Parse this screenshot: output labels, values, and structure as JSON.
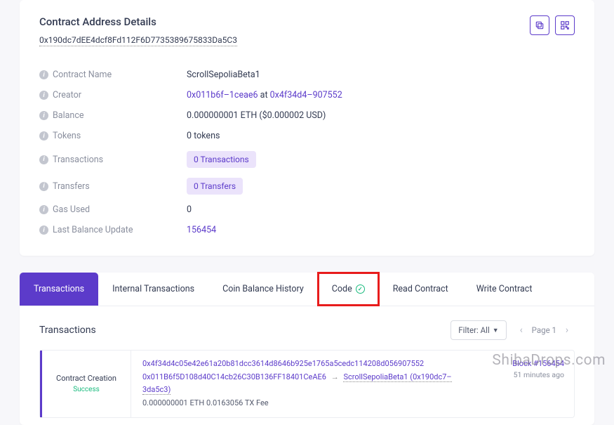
{
  "header": {
    "title": "Contract Address Details",
    "address": "0x190dc7dEE4dcf8Fd112F6D7735389675833Da5C3"
  },
  "details": {
    "contract_name": {
      "label": "Contract Name",
      "value": "ScrollSepoliaBeta1"
    },
    "creator": {
      "label": "Creator",
      "addr": "0x011b6f–1ceae6",
      "at": " at ",
      "tx": "0x4f34d4–907552"
    },
    "balance": {
      "label": "Balance",
      "value": "0.000000001 ETH ($0.000002 USD)"
    },
    "tokens": {
      "label": "Tokens",
      "value": "0 tokens"
    },
    "transactions": {
      "label": "Transactions",
      "badge": "0 Transactions"
    },
    "transfers": {
      "label": "Transfers",
      "badge": "0 Transfers"
    },
    "gas_used": {
      "label": "Gas Used",
      "value": "0"
    },
    "last_balance": {
      "label": "Last Balance Update",
      "link": "156454"
    }
  },
  "tabs": [
    {
      "label": "Transactions"
    },
    {
      "label": "Internal Transactions"
    },
    {
      "label": "Coin Balance History"
    },
    {
      "label": "Code"
    },
    {
      "label": "Read Contract"
    },
    {
      "label": "Write Contract"
    }
  ],
  "tx_section": {
    "title": "Transactions",
    "filter_label": "Filter: All",
    "page_label": "Page 1"
  },
  "tx_row": {
    "type": "Contract Creation",
    "status": "Success",
    "hash": "0x4f34d4c05e42e61a20b81dcc3614d8646b925e1765a5cedc114208d056907552",
    "from": "0x011B6f5D108d40C14cb26C30B136FF18401CeAE6",
    "to": "ScrollSepoliaBeta1 (0x190dc7–3da5c3)",
    "fee": "0.000000001 ETH 0.0163056 TX Fee",
    "block": "Block #156454",
    "time": "51 minutes ago"
  },
  "watermark": "ShibaDrops.com"
}
